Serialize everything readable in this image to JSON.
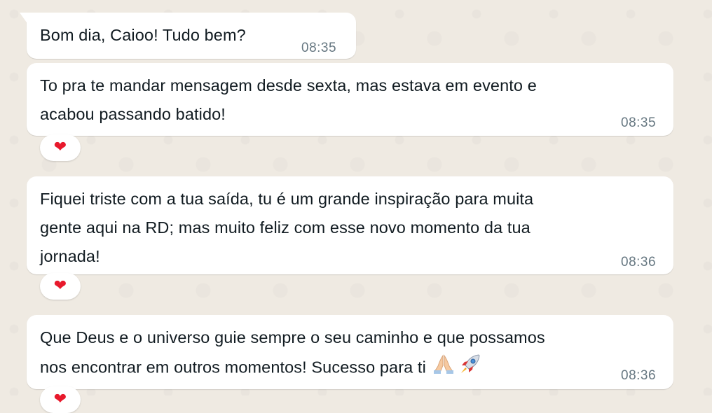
{
  "messages": [
    {
      "text": "Bom dia, Caioo! Tudo bem?",
      "time": "08:35",
      "reaction": null
    },
    {
      "text": "To pra te mandar mensagem desde sexta, mas estava em evento e\nacabou passando batido!",
      "time": "08:35",
      "reaction": "heart-icon"
    },
    {
      "text": "Fiquei triste com a tua saída, tu é um grande inspiração para muita\ngente aqui na RD; mas muito feliz com esse novo momento da tua\njornada!",
      "time": "08:36",
      "reaction": "heart-icon"
    },
    {
      "text": "Que Deus e o universo guie sempre o seu caminho e que possamos\nnos encontrar em outros momentos! Sucesso para ti",
      "emojis": [
        "folded-hands-icon",
        "rocket-icon"
      ],
      "time": "08:36",
      "reaction": "heart-icon"
    }
  ],
  "colors": {
    "background": "#efeae2",
    "bubble": "#ffffff",
    "text": "#111b21",
    "time": "#667781",
    "heart": "#e8192c"
  }
}
